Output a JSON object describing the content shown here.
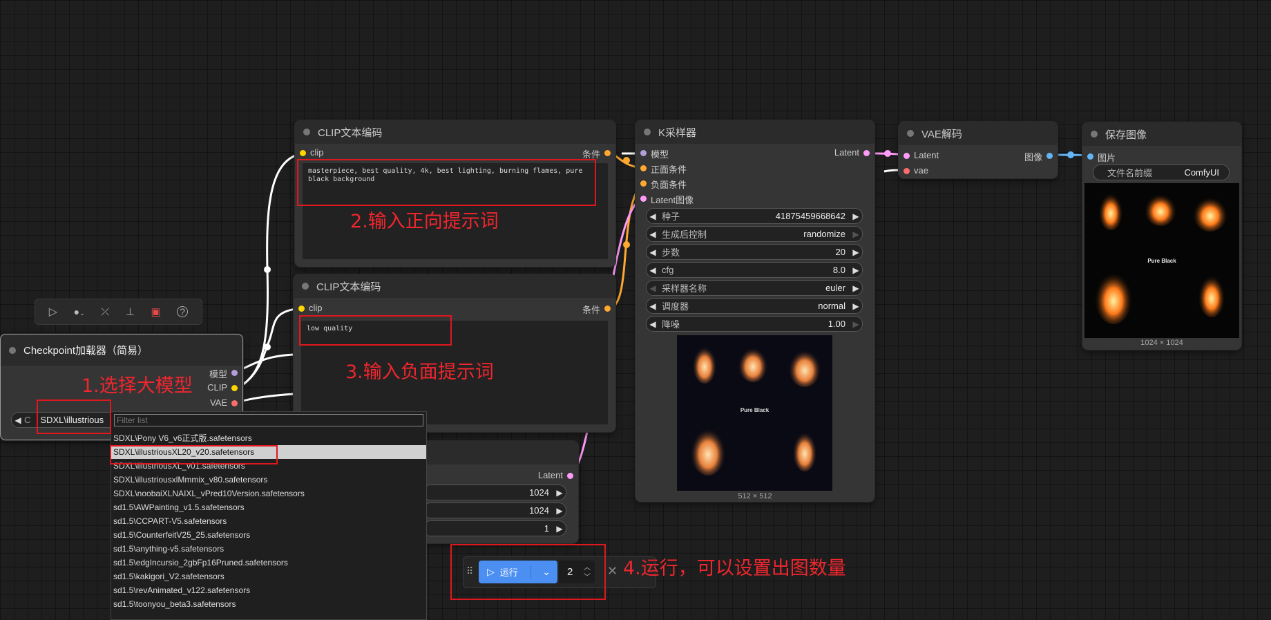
{
  "toolbar": {
    "icons": [
      "play-icon",
      "color-circle-icon",
      "bypass-icon",
      "pin-icon",
      "trash-icon",
      "help-icon"
    ]
  },
  "clip_pos": {
    "title": "CLIP文本编码",
    "in_clip": "clip",
    "out_cond": "条件",
    "text": "masterpiece, best quality, 4k, best lighting, burning flames, pure black background"
  },
  "clip_neg": {
    "title": "CLIP文本编码",
    "in_clip": "clip",
    "out_cond": "条件",
    "text": "low quality"
  },
  "checkpoint": {
    "title": "Checkpoint加载器（简易）",
    "out_model": "模型",
    "out_clip": "CLIP",
    "out_vae": "VAE",
    "widget_label": "C",
    "widget_value": "SDXL\\illustrious"
  },
  "dropdown": {
    "placeholder": "Filter list",
    "items": [
      "SDXL\\Pony V6_v6正式版.safetensors",
      "SDXL\\illustriousXL20_v20.safetensors",
      "SDXL\\illustriousXL_v01.safetensors",
      "SDXL\\illustriousxlMmmix_v80.safetensors",
      "SDXL\\noobaiXLNAIXL_vPred10Version.safetensors",
      "sd1.5\\AWPainting_v1.5.safetensors",
      "sd1.5\\CCPART-V5.safetensors",
      "sd1.5\\CounterfeitV25_25.safetensors",
      "sd1.5\\anything-v5.safetensors",
      "sd1.5\\edgIncursio_2gbFp16Pruned.safetensors",
      "sd1.5\\kakigori_V2.safetensors",
      "sd1.5\\revAnimated_v122.safetensors",
      "sd1.5\\toonyou_beta3.safetensors"
    ],
    "selected_index": 1
  },
  "latent_node": {
    "out_latent": "Latent",
    "width": "1024",
    "height": "1024",
    "batch": "1"
  },
  "ksampler": {
    "title": "K采样器",
    "in_model": "模型",
    "in_pos": "正面条件",
    "in_neg": "负面条件",
    "in_latent": "Latent图像",
    "out_latent": "Latent",
    "seed_label": "种子",
    "seed_value": "41875459668642",
    "control_label": "生成后控制",
    "control_value": "randomize",
    "steps_label": "步数",
    "steps_value": "20",
    "cfg_label": "cfg",
    "cfg_value": "8.0",
    "sampler_label": "采样器名称",
    "sampler_value": "euler",
    "scheduler_label": "调度器",
    "scheduler_value": "normal",
    "denoise_label": "降噪",
    "denoise_value": "1.00",
    "preview_text": "Pure Black",
    "preview_size": "512 × 512"
  },
  "vae_decode": {
    "title": "VAE解码",
    "in_latent": "Latent",
    "in_vae": "vae",
    "out_image": "图像"
  },
  "save_image": {
    "title": "保存图像",
    "in_image": "图片",
    "prefix_label": "文件名前缀",
    "prefix_value": "ComfyUI",
    "preview_text": "Pure Black",
    "preview_size": "1024 × 1024"
  },
  "runbar": {
    "run_label": "运行",
    "count": "2"
  },
  "annotations": {
    "a1": "1.选择大模型",
    "a2": "2.输入正向提示词",
    "a3": "3.输入负面提示词",
    "a4": "4.运行，可以设置出图数量"
  },
  "colors": {
    "clip": "#ffd500",
    "conditioning": "#ffa931",
    "latent": "#ff9cf9",
    "vae": "#ff6e6e",
    "image": "#64b5f6",
    "model": "#b39ddb",
    "annotation": "#e0171e",
    "run_button": "#4b8ff2"
  }
}
